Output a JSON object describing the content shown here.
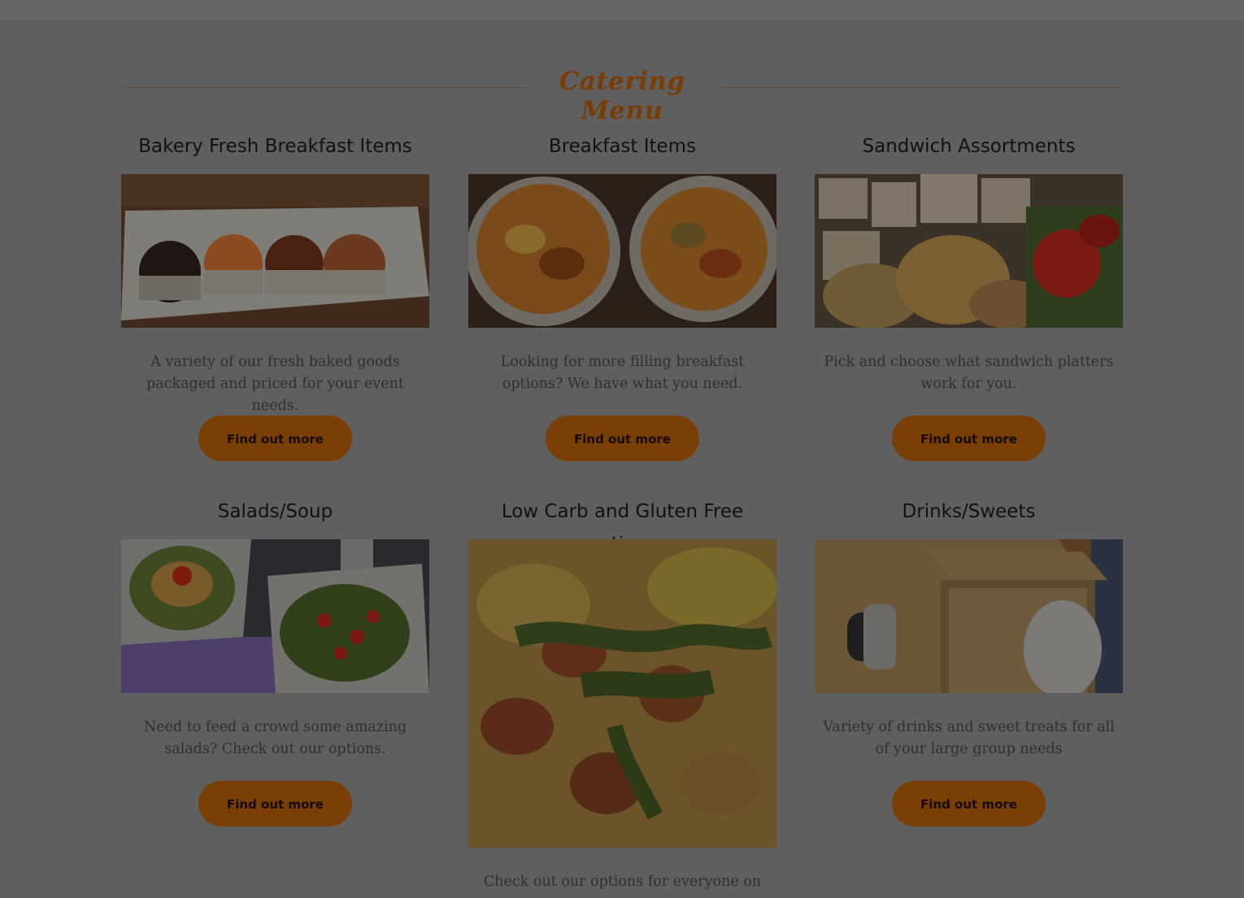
{
  "section": {
    "title": "Catering Menu"
  },
  "cards": [
    {
      "title": "Bakery Fresh Breakfast Items",
      "description": "A variety of our fresh baked goods packaged and priced for your event needs.",
      "button": "Find out more",
      "image": "muffins-photo"
    },
    {
      "title": "Breakfast Items",
      "description": "Looking for more filling breakfast options? We have what you need.",
      "button": "Find out more",
      "image": "quiche-photo"
    },
    {
      "title": "Sandwich Assortments",
      "description": "Pick and choose what sandwich platters work for you.",
      "button": "Find out more",
      "image": "sandwich-platter-photo"
    },
    {
      "title": "Salads/Soup",
      "description": "Need to feed a crowd some amazing salads? Check out our options.",
      "button": "Find out more",
      "image": "salads-photo"
    },
    {
      "title": "Low Carb and Gluten Free options",
      "description": "Check out our options for everyone on",
      "image": "frittata-photo"
    },
    {
      "title": "Drinks/Sweets",
      "description": "Variety of drinks and sweet treats for all of your large group needs",
      "button": "Find out more",
      "image": "drink-box-photo"
    }
  ],
  "colors": {
    "accent": "#7a3f05",
    "overlay_bg": "#5f5f5f"
  }
}
